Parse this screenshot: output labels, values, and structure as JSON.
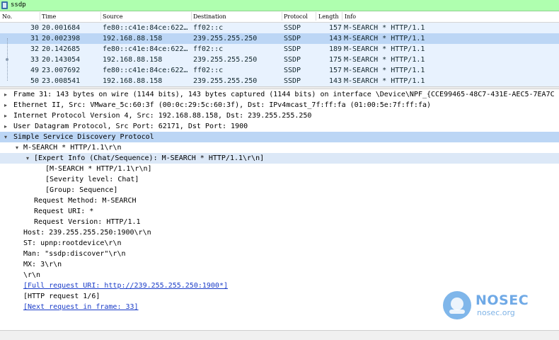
{
  "filter": {
    "value": "ssdp"
  },
  "packet_list": {
    "columns": [
      "No.",
      "Time",
      "Source",
      "Destination",
      "Protocol",
      "Length",
      "Info"
    ],
    "rows": [
      {
        "no": "30",
        "time": "20.001684",
        "src": "fe80::c41e:84ce:622…",
        "dst": "ff02::c",
        "proto": "SSDP",
        "len": "157",
        "info": "M-SEARCH * HTTP/1.1"
      },
      {
        "no": "31",
        "time": "20.002398",
        "src": "192.168.88.158",
        "dst": "239.255.255.250",
        "proto": "SSDP",
        "len": "143",
        "info": "M-SEARCH * HTTP/1.1"
      },
      {
        "no": "32",
        "time": "20.142685",
        "src": "fe80::c41e:84ce:622…",
        "dst": "ff02::c",
        "proto": "SSDP",
        "len": "189",
        "info": "M-SEARCH * HTTP/1.1"
      },
      {
        "no": "33",
        "time": "20.143054",
        "src": "192.168.88.158",
        "dst": "239.255.255.250",
        "proto": "SSDP",
        "len": "175",
        "info": "M-SEARCH * HTTP/1.1"
      },
      {
        "no": "49",
        "time": "23.007692",
        "src": "fe80::c41e:84ce:622…",
        "dst": "ff02::c",
        "proto": "SSDP",
        "len": "157",
        "info": "M-SEARCH * HTTP/1.1"
      },
      {
        "no": "50",
        "time": "23.008541",
        "src": "192.168.88.158",
        "dst": "239.255.255.250",
        "proto": "SSDP",
        "len": "143",
        "info": "M-SEARCH * HTTP/1.1"
      }
    ]
  },
  "details": [
    {
      "text": "Frame 31: 143 bytes on wire (1144 bits), 143 bytes captured (1144 bits) on interface \\Device\\NPF_{CCE99465-48C7-431E-AEC5-7EA7C"
    },
    {
      "text": "Ethernet II, Src: VMware_5c:60:3f (00:0c:29:5c:60:3f), Dst: IPv4mcast_7f:ff:fa (01:00:5e:7f:ff:fa)"
    },
    {
      "text": "Internet Protocol Version 4, Src: 192.168.88.158, Dst: 239.255.255.250"
    },
    {
      "text": "User Datagram Protocol, Src Port: 62171, Dst Port: 1900"
    },
    {
      "text": "Simple Service Discovery Protocol"
    },
    {
      "text": "M-SEARCH * HTTP/1.1\\r\\n"
    },
    {
      "text": "[Expert Info (Chat/Sequence): M-SEARCH * HTTP/1.1\\r\\n]"
    },
    {
      "text": "[M-SEARCH * HTTP/1.1\\r\\n]"
    },
    {
      "text": "[Severity level: Chat]"
    },
    {
      "text": "[Group: Sequence]"
    },
    {
      "text": "Request Method: M-SEARCH"
    },
    {
      "text": "Request URI: *"
    },
    {
      "text": "Request Version: HTTP/1.1"
    },
    {
      "text": "Host: 239.255.255.250:1900\\r\\n"
    },
    {
      "text": "ST: upnp:rootdevice\\r\\n"
    },
    {
      "text": "Man: \"ssdp:discover\"\\r\\n"
    },
    {
      "text": "MX: 3\\r\\n"
    },
    {
      "text": "\\r\\n"
    },
    {
      "text": "[Full request URI: http://239.255.255.250:1900*]"
    },
    {
      "text": "[HTTP request 1/6]"
    },
    {
      "text": "[Next request in frame: 33]"
    }
  ],
  "watermark": {
    "name": "NOSEC",
    "site": "nosec.org"
  },
  "colors": {
    "filter_bg": "#afffaf",
    "row_bg": "#e8f2fe",
    "row_selected": "#bcd6f5",
    "link": "#1a3cc8"
  }
}
